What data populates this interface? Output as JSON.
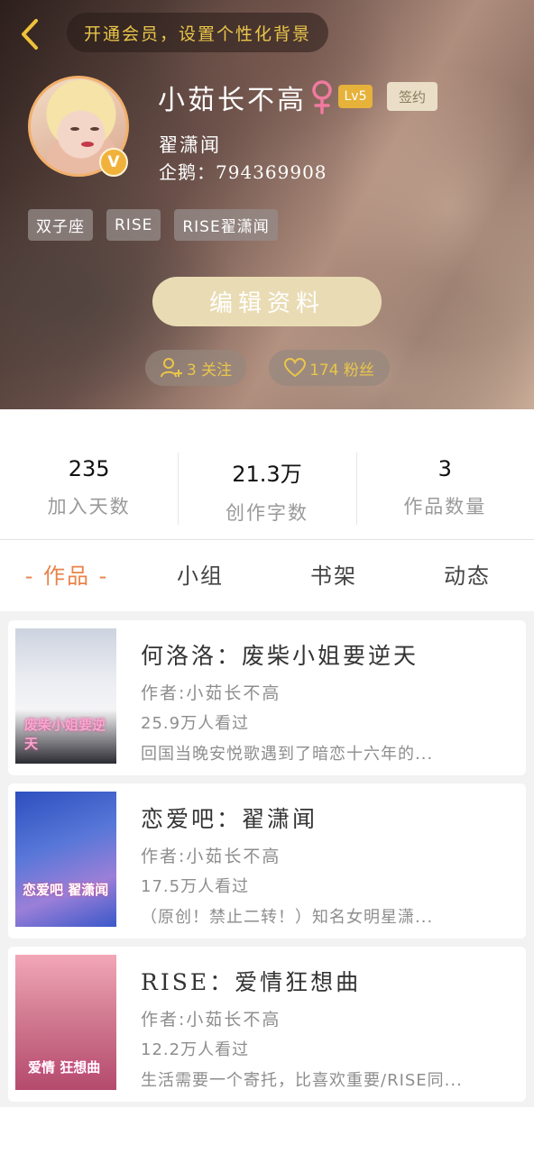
{
  "header": {
    "vip_banner": "开通会员，设置个性化背景",
    "username": "小茹长不高",
    "level": "Lv5",
    "sign_button": "签约",
    "realname": "翟潇闻",
    "penguin_line": "企鹅：794369908",
    "tags": [
      "双子座",
      "RISE",
      "RISE翟潇闻"
    ],
    "edit_button": "编辑资料",
    "following": "3 关注",
    "fans": "174 粉丝",
    "verified_badge": "V"
  },
  "stats": [
    {
      "value": "235",
      "label": "加入天数"
    },
    {
      "value": "21.3万",
      "label": "创作字数"
    },
    {
      "value": "3",
      "label": "作品数量"
    }
  ],
  "tabs": [
    "- 作品 -",
    "小组",
    "书架",
    "动态"
  ],
  "works": [
    {
      "title": "何洛洛：废柴小姐要逆天",
      "author": "作者:小茹长不高",
      "views": "25.9万人看过",
      "desc": "回国当晚安悦歌遇到了暗恋十六年的...",
      "cover_text": "废柴小姐要逆天"
    },
    {
      "title": "恋爱吧：翟潇闻",
      "author": "作者:小茹长不高",
      "views": "17.5万人看过",
      "desc": "（原创！禁止二转！）知名女明星潇...",
      "cover_text": "恋爱吧 翟潇闻"
    },
    {
      "title": "RISE：爱情狂想曲",
      "author": "作者:小茹长不高",
      "views": "12.2万人看过",
      "desc": "生活需要一个寄托，比喜欢重要/RISE同...",
      "cover_text": "爱情 狂想曲"
    }
  ],
  "colors": {
    "accent_orange": "#e8834a",
    "gold": "#e9c64a",
    "level_badge": "#e6b23a"
  }
}
